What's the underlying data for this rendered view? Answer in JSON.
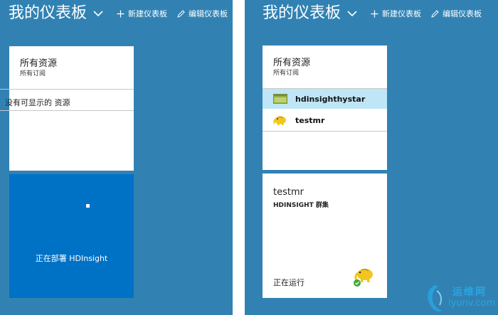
{
  "colors": {
    "background": "#3182b3",
    "tile": "#ffffff",
    "deploy_tile": "#0072c6",
    "selected_row": "#bfe6f6",
    "status_ok": "#3aa935"
  },
  "header": {
    "title": "我的仪表板",
    "new_dashboard": "新建仪表板",
    "edit_dashboard": "编辑仪表板",
    "chevron_icon": "chevron-down-icon",
    "plus_icon": "plus-icon",
    "pencil_icon": "pencil-icon"
  },
  "left": {
    "resources": {
      "title": "所有资源",
      "subtitle": "所有订阅",
      "empty_message": "没有可显示的 资源"
    },
    "deploy": {
      "status": "正在部署 HDInsight"
    }
  },
  "right": {
    "resources": {
      "title": "所有资源",
      "subtitle": "所有订阅",
      "items": [
        {
          "name": "hdinsighthystar",
          "icon": "storage-account-icon",
          "selected": true
        },
        {
          "name": "testmr",
          "icon": "hadoop-elephant-icon",
          "selected": false
        }
      ]
    },
    "cluster": {
      "name": "testmr",
      "type": "HDINSIGHT 群集",
      "status": "正在运行",
      "icon": "hadoop-elephant-icon"
    }
  },
  "watermark": {
    "text_cn": "运维网",
    "url": "iyunv.com"
  }
}
